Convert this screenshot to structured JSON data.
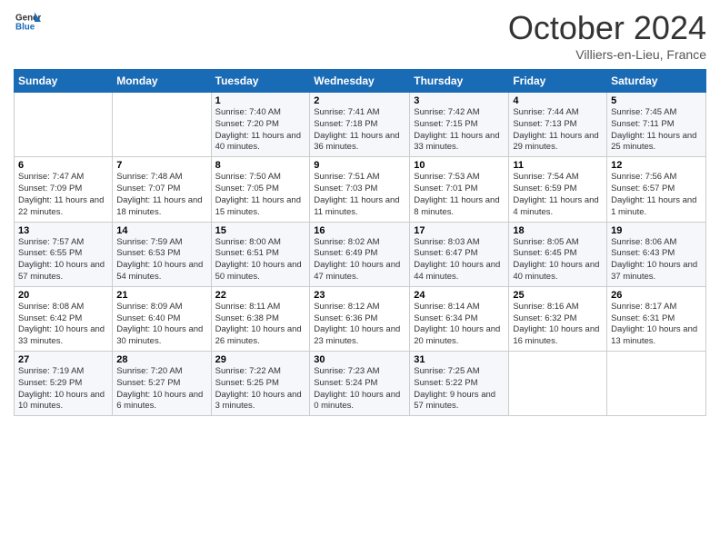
{
  "header": {
    "logo_line1": "General",
    "logo_line2": "Blue",
    "month_title": "October 2024",
    "location": "Villiers-en-Lieu, France"
  },
  "days_of_week": [
    "Sunday",
    "Monday",
    "Tuesday",
    "Wednesday",
    "Thursday",
    "Friday",
    "Saturday"
  ],
  "weeks": [
    [
      null,
      null,
      {
        "day": "1",
        "sunrise": "Sunrise: 7:40 AM",
        "sunset": "Sunset: 7:20 PM",
        "daylight": "Daylight: 11 hours and 40 minutes."
      },
      {
        "day": "2",
        "sunrise": "Sunrise: 7:41 AM",
        "sunset": "Sunset: 7:18 PM",
        "daylight": "Daylight: 11 hours and 36 minutes."
      },
      {
        "day": "3",
        "sunrise": "Sunrise: 7:42 AM",
        "sunset": "Sunset: 7:15 PM",
        "daylight": "Daylight: 11 hours and 33 minutes."
      },
      {
        "day": "4",
        "sunrise": "Sunrise: 7:44 AM",
        "sunset": "Sunset: 7:13 PM",
        "daylight": "Daylight: 11 hours and 29 minutes."
      },
      {
        "day": "5",
        "sunrise": "Sunrise: 7:45 AM",
        "sunset": "Sunset: 7:11 PM",
        "daylight": "Daylight: 11 hours and 25 minutes."
      }
    ],
    [
      {
        "day": "6",
        "sunrise": "Sunrise: 7:47 AM",
        "sunset": "Sunset: 7:09 PM",
        "daylight": "Daylight: 11 hours and 22 minutes."
      },
      {
        "day": "7",
        "sunrise": "Sunrise: 7:48 AM",
        "sunset": "Sunset: 7:07 PM",
        "daylight": "Daylight: 11 hours and 18 minutes."
      },
      {
        "day": "8",
        "sunrise": "Sunrise: 7:50 AM",
        "sunset": "Sunset: 7:05 PM",
        "daylight": "Daylight: 11 hours and 15 minutes."
      },
      {
        "day": "9",
        "sunrise": "Sunrise: 7:51 AM",
        "sunset": "Sunset: 7:03 PM",
        "daylight": "Daylight: 11 hours and 11 minutes."
      },
      {
        "day": "10",
        "sunrise": "Sunrise: 7:53 AM",
        "sunset": "Sunset: 7:01 PM",
        "daylight": "Daylight: 11 hours and 8 minutes."
      },
      {
        "day": "11",
        "sunrise": "Sunrise: 7:54 AM",
        "sunset": "Sunset: 6:59 PM",
        "daylight": "Daylight: 11 hours and 4 minutes."
      },
      {
        "day": "12",
        "sunrise": "Sunrise: 7:56 AM",
        "sunset": "Sunset: 6:57 PM",
        "daylight": "Daylight: 11 hours and 1 minute."
      }
    ],
    [
      {
        "day": "13",
        "sunrise": "Sunrise: 7:57 AM",
        "sunset": "Sunset: 6:55 PM",
        "daylight": "Daylight: 10 hours and 57 minutes."
      },
      {
        "day": "14",
        "sunrise": "Sunrise: 7:59 AM",
        "sunset": "Sunset: 6:53 PM",
        "daylight": "Daylight: 10 hours and 54 minutes."
      },
      {
        "day": "15",
        "sunrise": "Sunrise: 8:00 AM",
        "sunset": "Sunset: 6:51 PM",
        "daylight": "Daylight: 10 hours and 50 minutes."
      },
      {
        "day": "16",
        "sunrise": "Sunrise: 8:02 AM",
        "sunset": "Sunset: 6:49 PM",
        "daylight": "Daylight: 10 hours and 47 minutes."
      },
      {
        "day": "17",
        "sunrise": "Sunrise: 8:03 AM",
        "sunset": "Sunset: 6:47 PM",
        "daylight": "Daylight: 10 hours and 44 minutes."
      },
      {
        "day": "18",
        "sunrise": "Sunrise: 8:05 AM",
        "sunset": "Sunset: 6:45 PM",
        "daylight": "Daylight: 10 hours and 40 minutes."
      },
      {
        "day": "19",
        "sunrise": "Sunrise: 8:06 AM",
        "sunset": "Sunset: 6:43 PM",
        "daylight": "Daylight: 10 hours and 37 minutes."
      }
    ],
    [
      {
        "day": "20",
        "sunrise": "Sunrise: 8:08 AM",
        "sunset": "Sunset: 6:42 PM",
        "daylight": "Daylight: 10 hours and 33 minutes."
      },
      {
        "day": "21",
        "sunrise": "Sunrise: 8:09 AM",
        "sunset": "Sunset: 6:40 PM",
        "daylight": "Daylight: 10 hours and 30 minutes."
      },
      {
        "day": "22",
        "sunrise": "Sunrise: 8:11 AM",
        "sunset": "Sunset: 6:38 PM",
        "daylight": "Daylight: 10 hours and 26 minutes."
      },
      {
        "day": "23",
        "sunrise": "Sunrise: 8:12 AM",
        "sunset": "Sunset: 6:36 PM",
        "daylight": "Daylight: 10 hours and 23 minutes."
      },
      {
        "day": "24",
        "sunrise": "Sunrise: 8:14 AM",
        "sunset": "Sunset: 6:34 PM",
        "daylight": "Daylight: 10 hours and 20 minutes."
      },
      {
        "day": "25",
        "sunrise": "Sunrise: 8:16 AM",
        "sunset": "Sunset: 6:32 PM",
        "daylight": "Daylight: 10 hours and 16 minutes."
      },
      {
        "day": "26",
        "sunrise": "Sunrise: 8:17 AM",
        "sunset": "Sunset: 6:31 PM",
        "daylight": "Daylight: 10 hours and 13 minutes."
      }
    ],
    [
      {
        "day": "27",
        "sunrise": "Sunrise: 7:19 AM",
        "sunset": "Sunset: 5:29 PM",
        "daylight": "Daylight: 10 hours and 10 minutes."
      },
      {
        "day": "28",
        "sunrise": "Sunrise: 7:20 AM",
        "sunset": "Sunset: 5:27 PM",
        "daylight": "Daylight: 10 hours and 6 minutes."
      },
      {
        "day": "29",
        "sunrise": "Sunrise: 7:22 AM",
        "sunset": "Sunset: 5:25 PM",
        "daylight": "Daylight: 10 hours and 3 minutes."
      },
      {
        "day": "30",
        "sunrise": "Sunrise: 7:23 AM",
        "sunset": "Sunset: 5:24 PM",
        "daylight": "Daylight: 10 hours and 0 minutes."
      },
      {
        "day": "31",
        "sunrise": "Sunrise: 7:25 AM",
        "sunset": "Sunset: 5:22 PM",
        "daylight": "Daylight: 9 hours and 57 minutes."
      },
      null,
      null
    ]
  ]
}
